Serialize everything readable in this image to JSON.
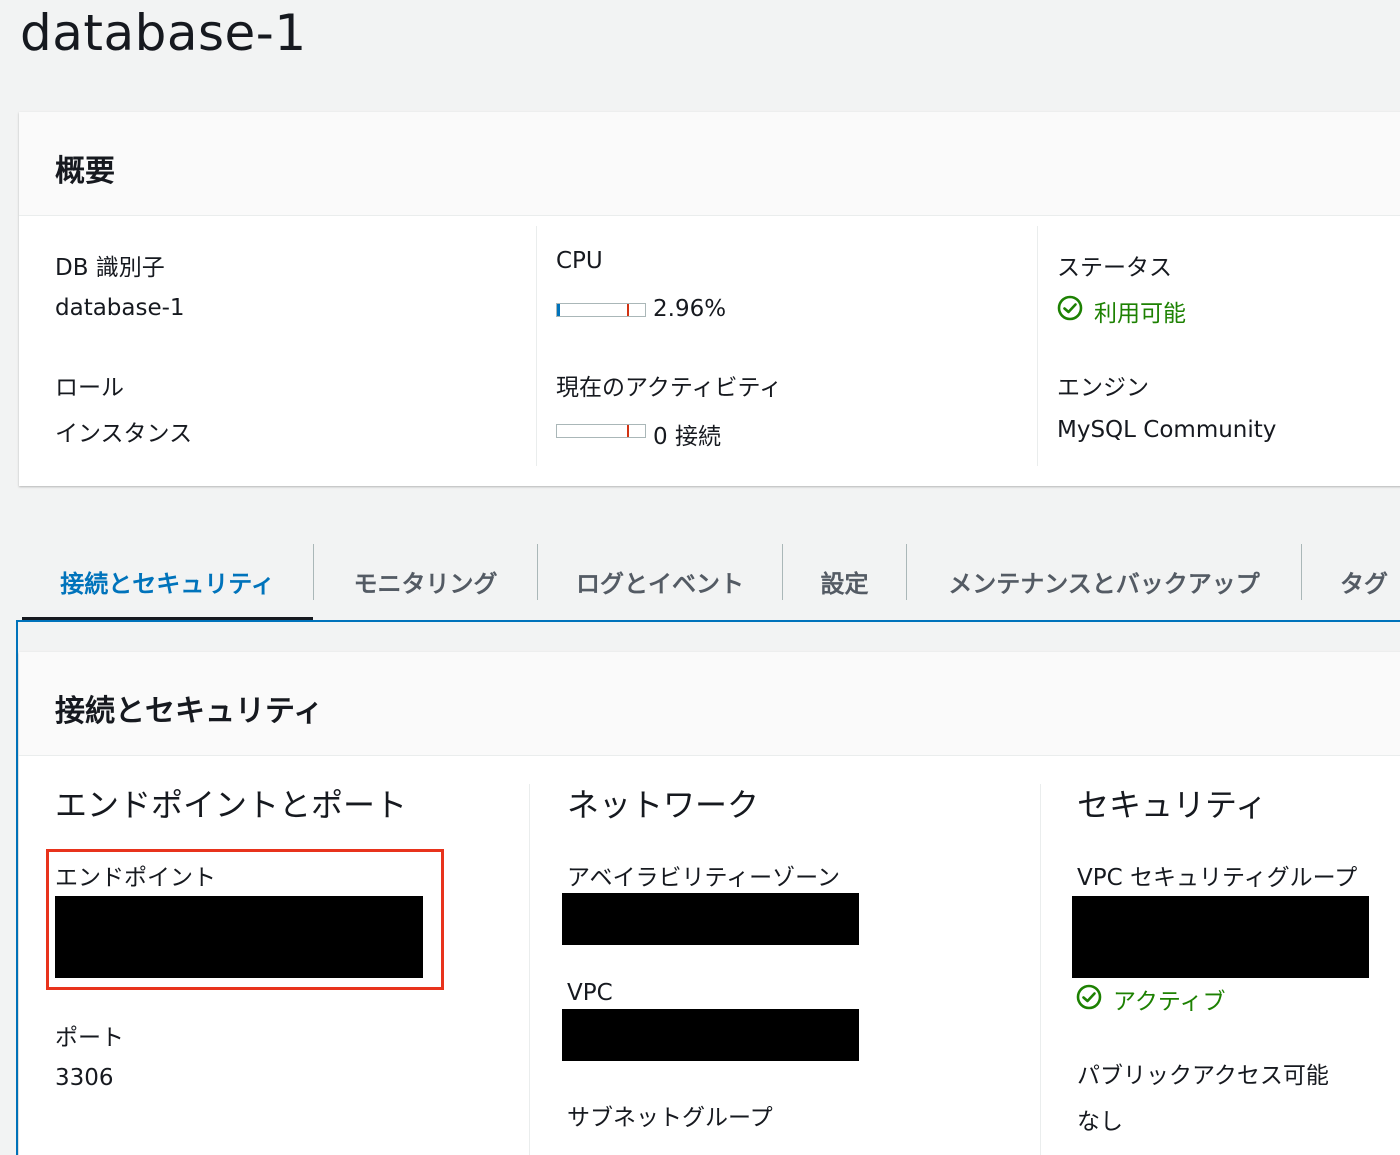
{
  "page": {
    "title": "database-1"
  },
  "summary": {
    "title": "概要",
    "db_identifier_label": "DB 識別子",
    "db_identifier_value": "database-1",
    "role_label": "ロール",
    "role_value": "インスタンス",
    "cpu_label": "CPU",
    "cpu_value": "2.96%",
    "cpu_fraction": 0.0296,
    "activity_label": "現在のアクティビティ",
    "activity_value": "0 接続",
    "status_label": "ステータス",
    "status_value": "利用可能",
    "engine_label": "エンジン",
    "engine_value": "MySQL Community"
  },
  "tabs": [
    {
      "label": "接続とセキュリティ",
      "active": true
    },
    {
      "label": "モニタリング",
      "active": false
    },
    {
      "label": "ログとイベント",
      "active": false
    },
    {
      "label": "設定",
      "active": false
    },
    {
      "label": "メンテナンスとバックアップ",
      "active": false
    },
    {
      "label": "タグ",
      "active": false
    }
  ],
  "connectivity": {
    "title": "接続とセキュリティ",
    "endpoint_section": {
      "title": "エンドポイントとポート",
      "endpoint_label": "エンドポイント",
      "port_label": "ポート",
      "port_value": "3306"
    },
    "network_section": {
      "title": "ネットワーク",
      "az_label": "アベイラビリティーゾーン",
      "vpc_label": "VPC",
      "subnet_group_label": "サブネットグループ"
    },
    "security_section": {
      "title": "セキュリティ",
      "vpc_sg_label": "VPC セキュリティグループ",
      "vpc_sg_status": "アクティブ",
      "public_access_label": "パブリックアクセス可能",
      "public_access_value": "なし"
    }
  },
  "colors": {
    "accent": "#0073bb",
    "success": "#1d8102",
    "highlight": "#e8331c",
    "background": "#f2f3f3"
  }
}
